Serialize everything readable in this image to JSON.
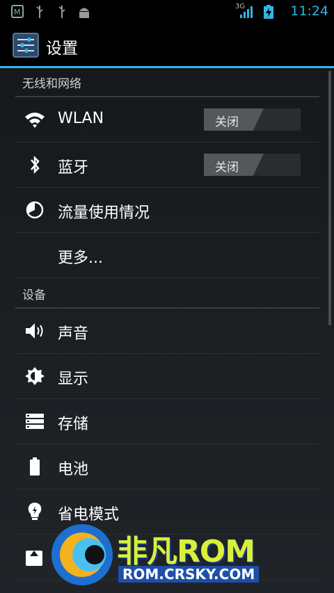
{
  "status_bar": {
    "time": "11:24",
    "network": "3G",
    "icons": [
      "mail-app-icon",
      "usb-icon",
      "usb-icon",
      "android-debug-icon",
      "signal-icon",
      "battery-charging-icon"
    ]
  },
  "action_bar": {
    "title": "设置",
    "icon": "settings-icon"
  },
  "sections": [
    {
      "header": "无线和网络",
      "items": [
        {
          "label": "WLAN",
          "icon": "wifi-icon",
          "switch": "关闭"
        },
        {
          "label": "蓝牙",
          "icon": "bluetooth-icon",
          "switch": "关闭"
        },
        {
          "label": "流量使用情况",
          "icon": "data-usage-icon"
        },
        {
          "label": "更多..."
        }
      ]
    },
    {
      "header": "设备",
      "items": [
        {
          "label": "声音",
          "icon": "speaker-icon"
        },
        {
          "label": "显示",
          "icon": "brightness-icon"
        },
        {
          "label": "存储",
          "icon": "storage-icon"
        },
        {
          "label": "电池",
          "icon": "battery-icon"
        },
        {
          "label": "省电模式",
          "icon": "lightbulb-icon"
        },
        {
          "label": "",
          "icon": "apps-icon"
        }
      ]
    }
  ],
  "watermark": {
    "brand": "非凡ROM",
    "url": "ROM.CRSKY.COM"
  },
  "colors": {
    "accent": "#33b5e5",
    "background": "#16191c"
  }
}
